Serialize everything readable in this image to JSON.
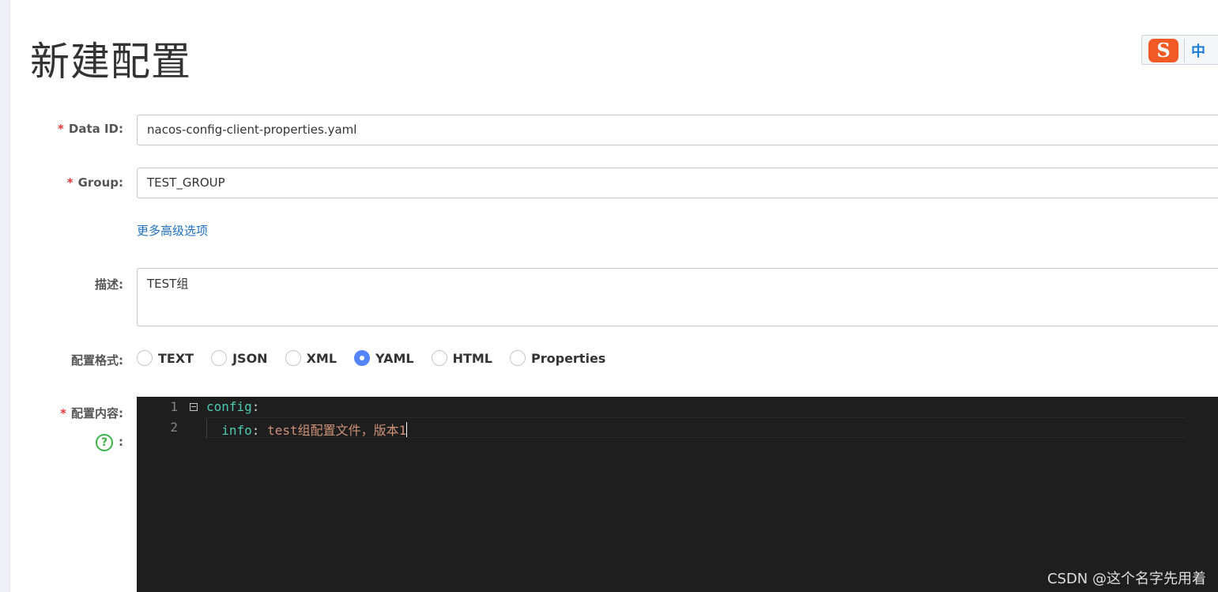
{
  "page": {
    "title": "新建配置"
  },
  "ime": {
    "logo": "S",
    "lang": "中"
  },
  "form": {
    "data_id": {
      "label": "Data ID:",
      "value": "nacos-config-client-properties.yaml"
    },
    "group": {
      "label": "Group:",
      "value": "TEST_GROUP"
    },
    "more_options": "更多高级选项",
    "description": {
      "label": "描述:",
      "value": "TEST组"
    },
    "format": {
      "label": "配置格式:",
      "options": [
        "TEXT",
        "JSON",
        "XML",
        "YAML",
        "HTML",
        "Properties"
      ],
      "selected": "YAML"
    },
    "content": {
      "label": "配置内容:",
      "help_icon": "?",
      "help_colon": ":",
      "line_numbers": [
        "1",
        "2"
      ],
      "lines": [
        {
          "key": "config",
          "sep": ":",
          "value": ""
        },
        {
          "key": "info",
          "sep": ":",
          "value": "test组配置文件，版本1"
        }
      ]
    }
  },
  "required_mark": "*",
  "watermark": "CSDN @这个名字先用着"
}
